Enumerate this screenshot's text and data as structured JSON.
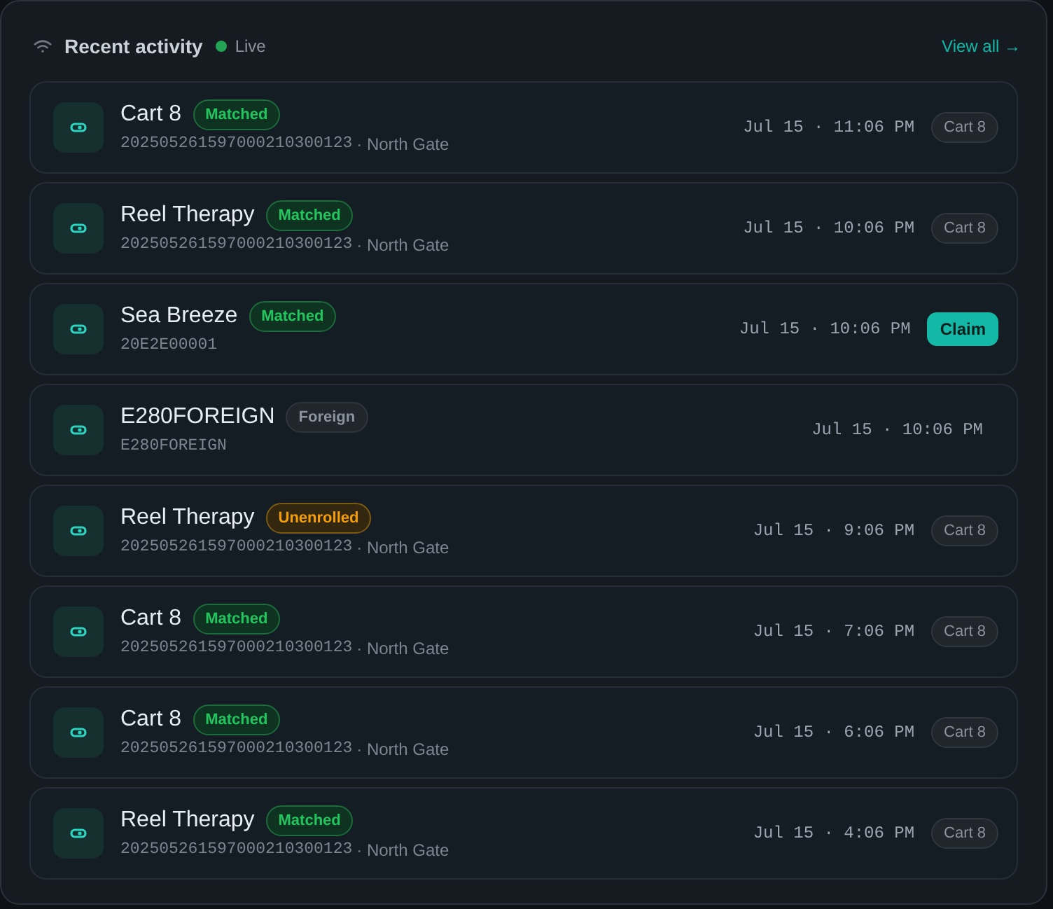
{
  "header": {
    "title": "Recent activity",
    "live": "Live",
    "link": "View all →"
  },
  "items": [
    {
      "title": "Cart 8",
      "status": {
        "kind": "matched",
        "label": "Matched"
      },
      "tag_id": "202505261597000210300123",
      "location": "· North Gate",
      "time": "Jul 15 · 11:06 PM",
      "action": {
        "kind": "tag",
        "label": "Cart 8"
      }
    },
    {
      "title": "Reel Therapy",
      "status": {
        "kind": "matched",
        "label": "Matched"
      },
      "tag_id": "202505261597000210300123",
      "location": "· North Gate",
      "time": "Jul 15 · 10:06 PM",
      "action": {
        "kind": "tag",
        "label": "Cart 8"
      }
    },
    {
      "title": "Sea Breeze",
      "status": {
        "kind": "matched",
        "label": "Matched"
      },
      "tag_id": "20E2E00001",
      "time": "Jul 15 · 10:06 PM",
      "action": {
        "kind": "button",
        "label": "Claim"
      }
    },
    {
      "title": "E280FOREIGN",
      "status": {
        "kind": "foreign",
        "label": "Foreign"
      },
      "tag_id": "E280FOREIGN",
      "time": "Jul 15 · 10:06 PM"
    },
    {
      "title": "Reel Therapy",
      "status": {
        "kind": "unenrolled",
        "label": "Unenrolled"
      },
      "tag_id": "202505261597000210300123",
      "location": "· North Gate",
      "time": "Jul 15 · 9:06 PM",
      "action": {
        "kind": "tag",
        "label": "Cart 8"
      }
    },
    {
      "title": "Cart 8",
      "status": {
        "kind": "matched",
        "label": "Matched"
      },
      "tag_id": "202505261597000210300123",
      "location": "· North Gate",
      "time": "Jul 15 · 7:06 PM",
      "action": {
        "kind": "tag",
        "label": "Cart 8"
      }
    },
    {
      "title": "Cart 8",
      "status": {
        "kind": "matched",
        "label": "Matched"
      },
      "tag_id": "202505261597000210300123",
      "location": "· North Gate",
      "time": "Jul 15 · 6:06 PM",
      "action": {
        "kind": "tag",
        "label": "Cart 8"
      }
    },
    {
      "title": "Reel Therapy",
      "status": {
        "kind": "matched",
        "label": "Matched"
      },
      "tag_id": "202505261597000210300123",
      "location": "· North Gate",
      "time": "Jul 15 · 4:06 PM",
      "action": {
        "kind": "tag",
        "label": "Cart 8"
      }
    }
  ]
}
